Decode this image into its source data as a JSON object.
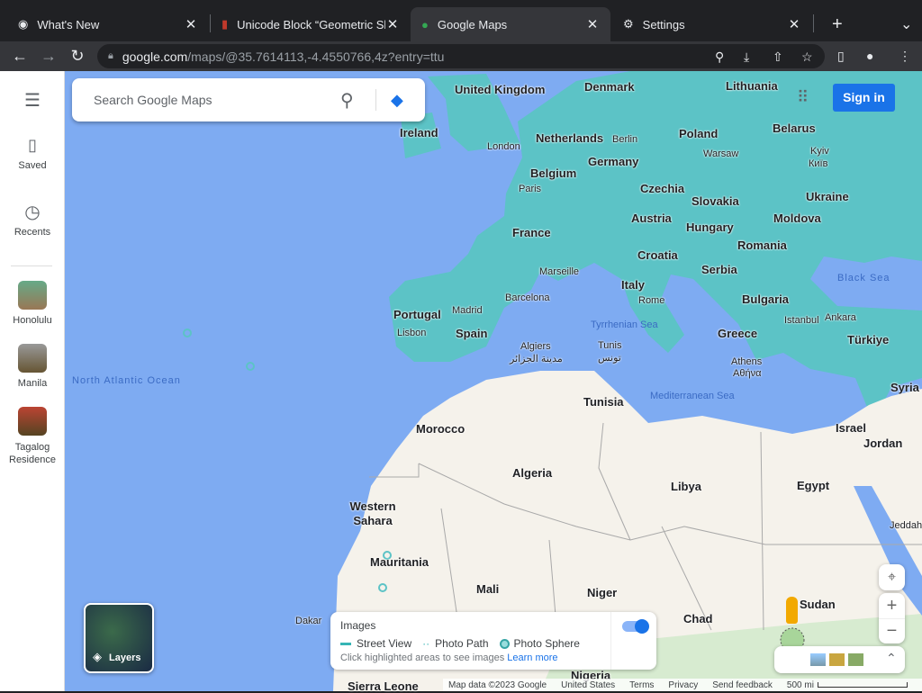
{
  "browser": {
    "tabs": [
      {
        "title": "What's New",
        "icon": "chrome-icon"
      },
      {
        "title": "Unicode Block “Geometric Sh",
        "icon": "unicode-icon"
      },
      {
        "title": "Google Maps",
        "icon": "maps-icon",
        "active": true
      },
      {
        "title": "Settings",
        "icon": "gear-icon"
      }
    ],
    "close": "✕",
    "new_tab": "+",
    "tab_menu": "⌄",
    "url_domain": "google.com",
    "url_path": "/maps/@35.7614113,-4.4550766,4z?entry=ttu"
  },
  "sidebar": {
    "menu": "☰",
    "items": [
      {
        "label": "Saved"
      },
      {
        "label": "Recents"
      }
    ],
    "places": [
      {
        "label": "Honolulu"
      },
      {
        "label": "Manila"
      },
      {
        "label": "Tagalog Residence"
      }
    ]
  },
  "search": {
    "placeholder": "Search Google Maps"
  },
  "sign_in": "Sign in",
  "layers": "Layers",
  "images_panel": {
    "title": "Images",
    "legend": [
      "Street View",
      "Photo Path",
      "Photo Sphere"
    ],
    "hint": "Click highlighted areas to see images",
    "learn_more": "Learn more",
    "toggle_on": true
  },
  "footer": {
    "map_data": "Map data ©2023 Google",
    "region": "United States",
    "terms": "Terms",
    "privacy": "Privacy",
    "feedback": "Send feedback",
    "scale": "500 mi"
  },
  "map": {
    "countries": [
      "United Kingdom",
      "Ireland",
      "Denmark",
      "Lithuania",
      "Netherlands",
      "Germany",
      "Poland",
      "Belarus",
      "Belgium",
      "Czechia",
      "Slovakia",
      "Ukraine",
      "France",
      "Austria",
      "Hungary",
      "Moldova",
      "Romania",
      "Croatia",
      "Serbia",
      "Italy",
      "Bulgaria",
      "Portugal",
      "Spain",
      "Greece",
      "Türkiye",
      "Tunisia",
      "Morocco",
      "Algeria",
      "Libya",
      "Egypt",
      "Syria",
      "Israel",
      "Jordan",
      "Western Sahara",
      "Mauritania",
      "Mali",
      "Niger",
      "Chad",
      "Sudan",
      "Nigeria",
      "Sierra Leone"
    ],
    "cities": [
      "London",
      "Berlin",
      "Warsaw",
      "Paris",
      "Kyiv",
      "Київ",
      "Marseille",
      "Barcelona",
      "Madrid",
      "Rome",
      "Lisbon",
      "Algiers",
      "مدينة الجزائر",
      "Tunis",
      "تونس",
      "Athens",
      "Αθήνα",
      "Istanbul",
      "Ankara",
      "Dakar",
      "Jeddah"
    ],
    "waters": [
      "North Atlantic Ocean",
      "Black Sea",
      "Mediterranean Sea",
      "Tyrrhenian Sea"
    ]
  }
}
